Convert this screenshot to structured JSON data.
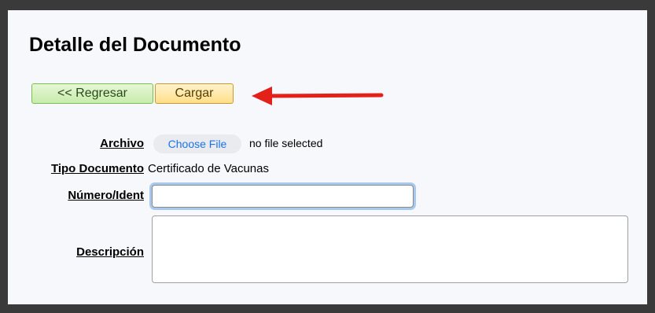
{
  "page": {
    "title": "Detalle del Documento"
  },
  "buttons": {
    "back_label": "<< Regresar",
    "load_label": "Cargar"
  },
  "form": {
    "file_label": "Archivo",
    "file_button": "Choose File",
    "file_status": "no file selected",
    "doc_type_label": "Tipo Documento",
    "doc_type_value": "Certificado de Vacunas",
    "number_label": "Número/Ident",
    "number_value": "",
    "description_label": "Descripción",
    "description_value": ""
  },
  "colors": {
    "arrow": "#e32119",
    "back_button": "#c8ecac",
    "load_button": "#ffdf8a"
  }
}
